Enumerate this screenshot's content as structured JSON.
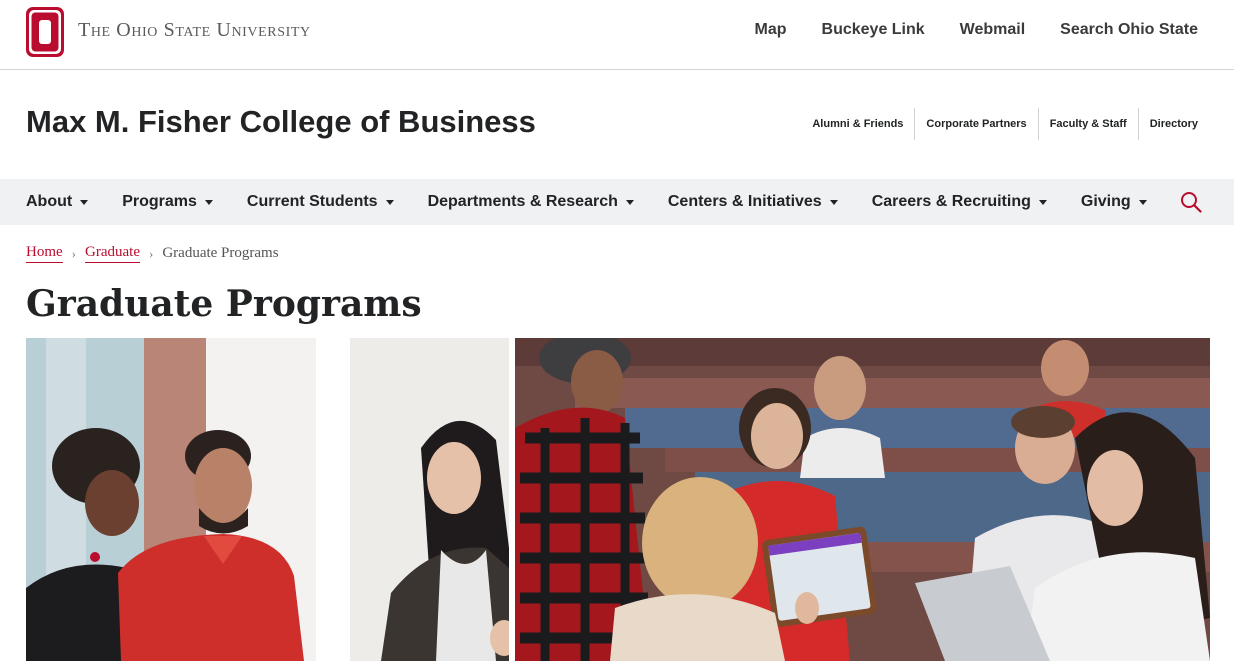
{
  "university": {
    "wordmark": "The Ohio State University",
    "links": [
      "Map",
      "Buckeye Link",
      "Webmail",
      "Search Ohio State"
    ]
  },
  "college": {
    "title": "Max M. Fisher College of Business",
    "links": [
      "Alumni & Friends",
      "Corporate Partners",
      "Faculty & Staff",
      "Directory"
    ]
  },
  "nav": {
    "items": [
      "About",
      "Programs",
      "Current Students",
      "Departments & Research",
      "Centers & Initiatives",
      "Careers & Recruiting",
      "Giving"
    ]
  },
  "breadcrumb": {
    "home": "Home",
    "graduate": "Graduate",
    "current": "Graduate Programs"
  },
  "page": {
    "title": "Graduate Programs"
  },
  "colors": {
    "scarlet": "#ba0c2f",
    "gray_nav": "#eff1f2",
    "text": "#212325"
  },
  "icons": {
    "logo": "block-o-logo",
    "search": "search-icon",
    "caret": "caret-down-icon"
  }
}
